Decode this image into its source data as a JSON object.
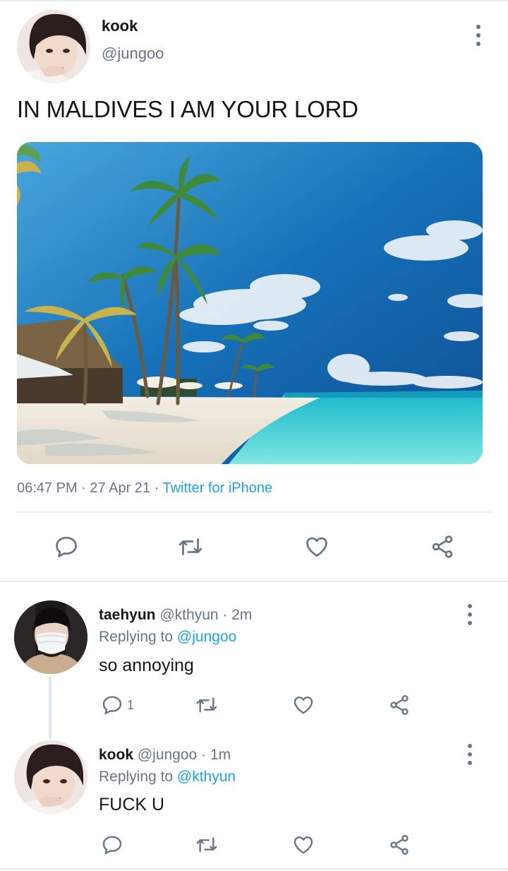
{
  "tweet": {
    "author_name": "kook",
    "author_handle": "@jungoo",
    "text": "IN MALDIVES I AM YOUR LORD",
    "time": "06:47 PM",
    "date": "27 Apr 21",
    "source": "Twitter for iPhone",
    "separator": "·"
  },
  "replies": [
    {
      "name": "taehyun",
      "handle": "@kthyun",
      "time": "2m",
      "replying_label": "Replying to",
      "replying_to": "@jungoo",
      "text": "so annoying",
      "reply_count": "1"
    },
    {
      "name": "kook",
      "handle": "@jungoo",
      "time": "1m",
      "replying_label": "Replying to",
      "replying_to": "@kthyun",
      "text": "FUCK U",
      "reply_count": ""
    }
  ],
  "icons": {
    "more": "more-vertical-icon",
    "reply": "comment-bubble-icon",
    "retweet": "retweet-arrows-icon",
    "like": "heart-icon",
    "share": "share-icon"
  },
  "colors": {
    "accent": "#1da1f2",
    "muted": "#657786",
    "text": "#14171a",
    "divider": "#e6ecf0"
  }
}
